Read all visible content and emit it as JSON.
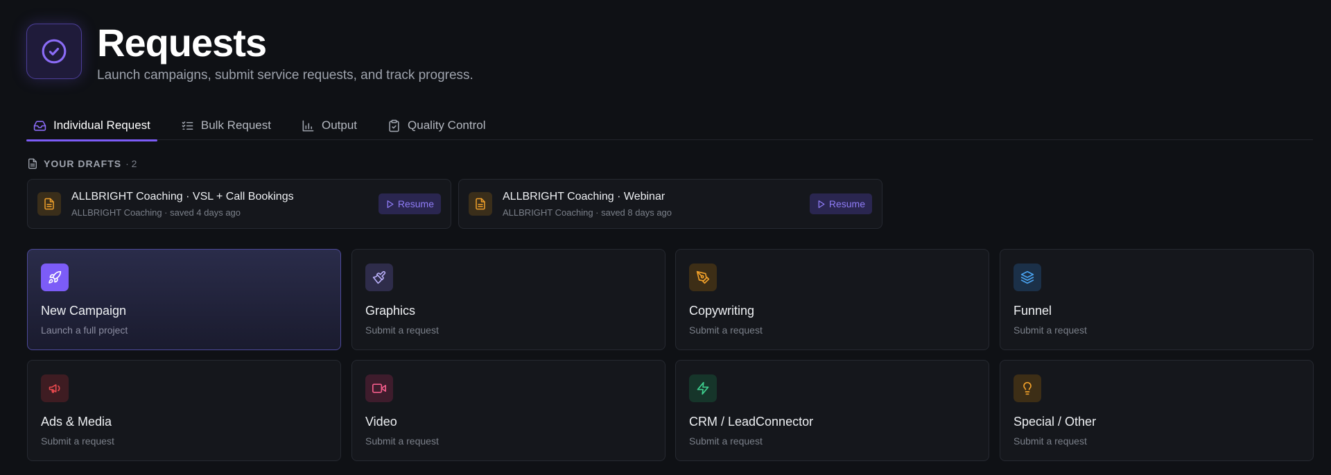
{
  "header": {
    "title": "Requests",
    "subtitle": "Launch campaigns, submit service requests, and track progress.",
    "logo_icon": "check-circle-icon"
  },
  "tabs": [
    {
      "label": "Individual Request",
      "icon": "inbox-icon",
      "active": true
    },
    {
      "label": "Bulk Request",
      "icon": "checklist-icon",
      "active": false
    },
    {
      "label": "Output",
      "icon": "bar-chart-icon",
      "active": false
    },
    {
      "label": "Quality Control",
      "icon": "clipboard-check-icon",
      "active": false
    }
  ],
  "drafts": {
    "heading": "YOUR DRAFTS",
    "count": "· 2",
    "items": [
      {
        "title": "ALLBRIGHT Coaching · VSL + Call Bookings",
        "meta": "ALLBRIGHT Coaching · saved 4 days ago",
        "action": "Resume"
      },
      {
        "title": "ALLBRIGHT Coaching · Webinar",
        "meta": "ALLBRIGHT Coaching · saved 8 days ago",
        "action": "Resume"
      }
    ]
  },
  "categories": [
    {
      "title": "New Campaign",
      "subtitle": "Launch a full project",
      "icon": "rocket-icon",
      "color": "#8b6cf7"
    },
    {
      "title": "Graphics",
      "subtitle": "Submit a request",
      "icon": "paintbrush-icon",
      "color": "#a99cf5"
    },
    {
      "title": "Copywriting",
      "subtitle": "Submit a request",
      "icon": "pen-tool-icon",
      "color": "#f0a02a"
    },
    {
      "title": "Funnel",
      "subtitle": "Submit a request",
      "icon": "layers-icon",
      "color": "#4aa3f0"
    },
    {
      "title": "Ads & Media",
      "subtitle": "Submit a request",
      "icon": "megaphone-icon",
      "color": "#e5484d"
    },
    {
      "title": "Video",
      "subtitle": "Submit a request",
      "icon": "video-icon",
      "color": "#f25c8a"
    },
    {
      "title": "CRM / LeadConnector",
      "subtitle": "Submit a request",
      "icon": "lightning-icon",
      "color": "#3ecf8e"
    },
    {
      "title": "Special / Other",
      "subtitle": "Submit a request",
      "icon": "lightbulb-icon",
      "color": "#f0a02a"
    }
  ],
  "colors": {
    "accent": "#7c5cf7",
    "background": "#0f1115",
    "card": "#15171c"
  }
}
